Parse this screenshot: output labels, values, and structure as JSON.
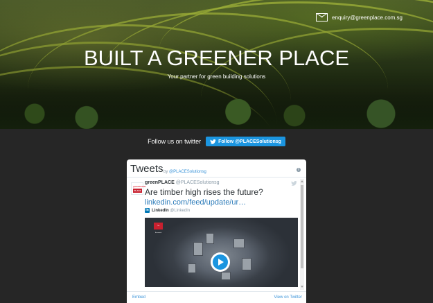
{
  "header": {
    "email": "enquiry@greenplace.com.sg",
    "email_icon": "envelope-icon",
    "title": "BUILT A GREENER PLACE",
    "subtitle": "Your partner for green building solutions"
  },
  "follow": {
    "label": "Follow us on twitter",
    "button": "Follow @PLACESolutionsg"
  },
  "widget": {
    "title": "Tweets",
    "by_prefix": "by",
    "by_handle": "@PLACESolutionsg",
    "tweet": {
      "author": "greenPLACE",
      "handle": "@PLACESolutionsg",
      "text": "Are timber high rises the future?",
      "link": "linkedin.com/feed/update/ur…",
      "card_source": "LinkedIn",
      "card_handle": "@LinkedIn",
      "avatar_top": "greenPLACE",
      "avatar_logo": "PLACE"
    },
    "media_badge": "The Economist",
    "footer_embed": "Embed",
    "footer_view": "View on Twitter"
  },
  "colors": {
    "page_bg": "#262626",
    "twitter_blue": "#1b95e0",
    "link_blue": "#2b7bb9"
  }
}
